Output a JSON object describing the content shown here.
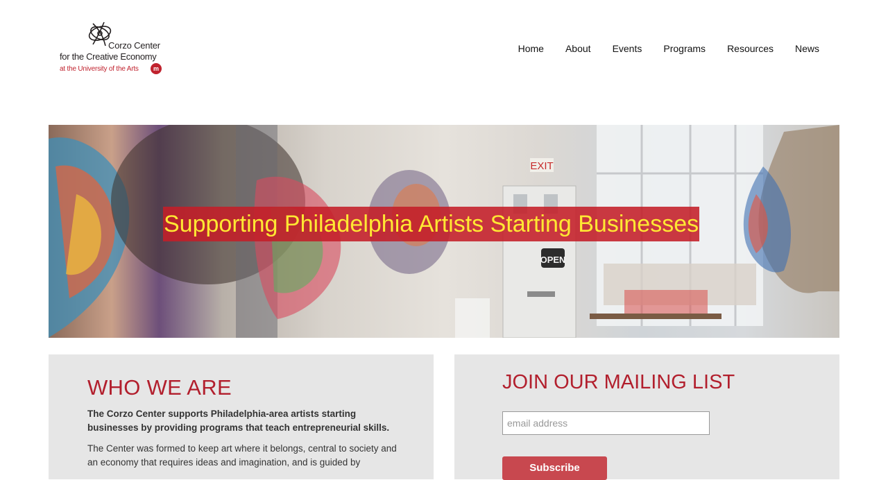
{
  "logo": {
    "line1": "Corzo Center",
    "line2": "for the Creative Economy",
    "line3": "at the University of the Arts",
    "badge": "m",
    "brand_red": "#c0222e"
  },
  "nav": {
    "items": [
      {
        "label": "Home"
      },
      {
        "label": "About"
      },
      {
        "label": "Events"
      },
      {
        "label": "Programs"
      },
      {
        "label": "Resources"
      },
      {
        "label": "News"
      }
    ]
  },
  "hero": {
    "title": "Supporting Philadelphia Artists Starting Businesses",
    "title_color": "#ffe833",
    "banner_color": "#c41e28",
    "exit_sign": "EXIT",
    "open_sign": "OPEN"
  },
  "who": {
    "title": "WHO WE ARE",
    "lead": "The Corzo Center supports Philadelphia-area artists starting businesses by providing programs that teach entrepreneurial skills.",
    "body": "The Center was formed to keep art where it belongs, central to society and an economy that requires ideas and imagination, and is guided by"
  },
  "mailing": {
    "title": "JOIN OUR MAILING LIST",
    "email_placeholder": "email address",
    "email_value": "",
    "subscribe_label": "Subscribe"
  },
  "colors": {
    "accent_red": "#b21f2d",
    "panel_bg": "#e6e6e6",
    "button_red": "#c8484f"
  }
}
